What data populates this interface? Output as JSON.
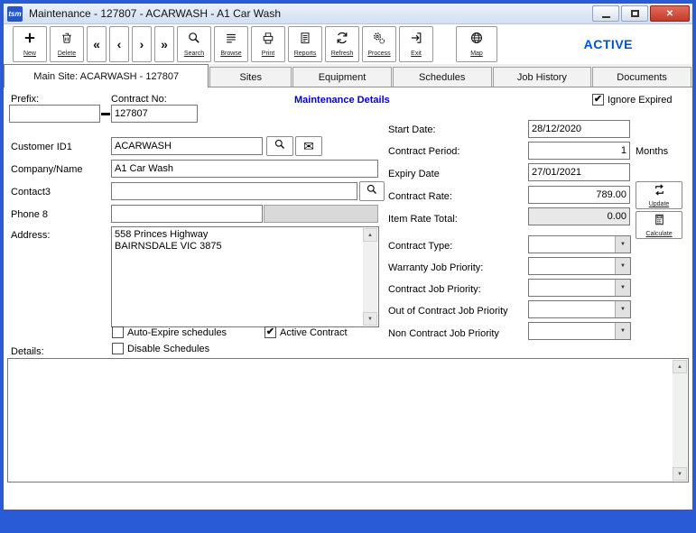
{
  "icons": {
    "check": "✔",
    "close": "✕",
    "dropdown_arrow": "▼",
    "scroll_up": "▲",
    "scroll_down": "▼",
    "mail": "✉"
  },
  "window": {
    "title": "Maintenance - 127807 - ACARWASH - A1 Car Wash",
    "logo": "tsm"
  },
  "toolbar": {
    "status": "ACTIVE",
    "nav": [
      "«",
      "‹",
      "›",
      "»"
    ],
    "buttons": [
      {
        "label": "New"
      },
      {
        "label": "Delete"
      },
      {
        "label": "Search"
      },
      {
        "label": "Browse"
      },
      {
        "label": "Print"
      },
      {
        "label": "Reports"
      },
      {
        "label": "Refresh"
      },
      {
        "label": "Process"
      },
      {
        "label": "Exit"
      },
      {
        "label": "Map"
      }
    ]
  },
  "tabs": [
    {
      "label": "Main Site: ACARWASH - 127807"
    },
    {
      "label": "Sites"
    },
    {
      "label": "Equipment"
    },
    {
      "label": "Schedules"
    },
    {
      "label": "Job History"
    },
    {
      "label": "Documents"
    }
  ],
  "form": {
    "prefix_label": "Prefix:",
    "contract_no_label": "Contract No:",
    "contract_no": "127807",
    "section_title": "Maintenance Details",
    "ignore_expired_label": "Ignore Expired",
    "customer_id_label": "Customer ID1",
    "customer_id": "ACARWASH",
    "company_label": "Company/Name",
    "company": "A1 Car Wash",
    "contact_label": "Contact3",
    "phone_label": "Phone 8",
    "address_label": "Address:",
    "address": "558 Princes Highway\nBAIRNSDALE VIC 3875",
    "auto_expire_label": "Auto-Expire schedules",
    "active_contract_label": "Active Contract",
    "disable_schedules_label": "Disable Schedules",
    "details_label": "Details:",
    "start_date_label": "Start Date:",
    "start_date": "28/12/2020",
    "contract_period_label": "Contract Period:",
    "contract_period": "1",
    "months_label": "Months",
    "expiry_date_label": "Expiry Date",
    "expiry_date": "27/01/2021",
    "contract_rate_label": "Contract Rate:",
    "contract_rate": "789.00",
    "item_rate_label": "Item Rate Total:",
    "item_rate": "0.00",
    "update_button_label": "Update",
    "calculate_button_label": "Calculate",
    "contract_type_label": "Contract Type:",
    "warranty_priority_label": "Warranty Job Priority:",
    "contract_priority_label": "Contract Job Priority:",
    "out_contract_priority_label": "Out of Contract Job Priority",
    "non_contract_priority_label": "Non Contract Job Priority"
  }
}
